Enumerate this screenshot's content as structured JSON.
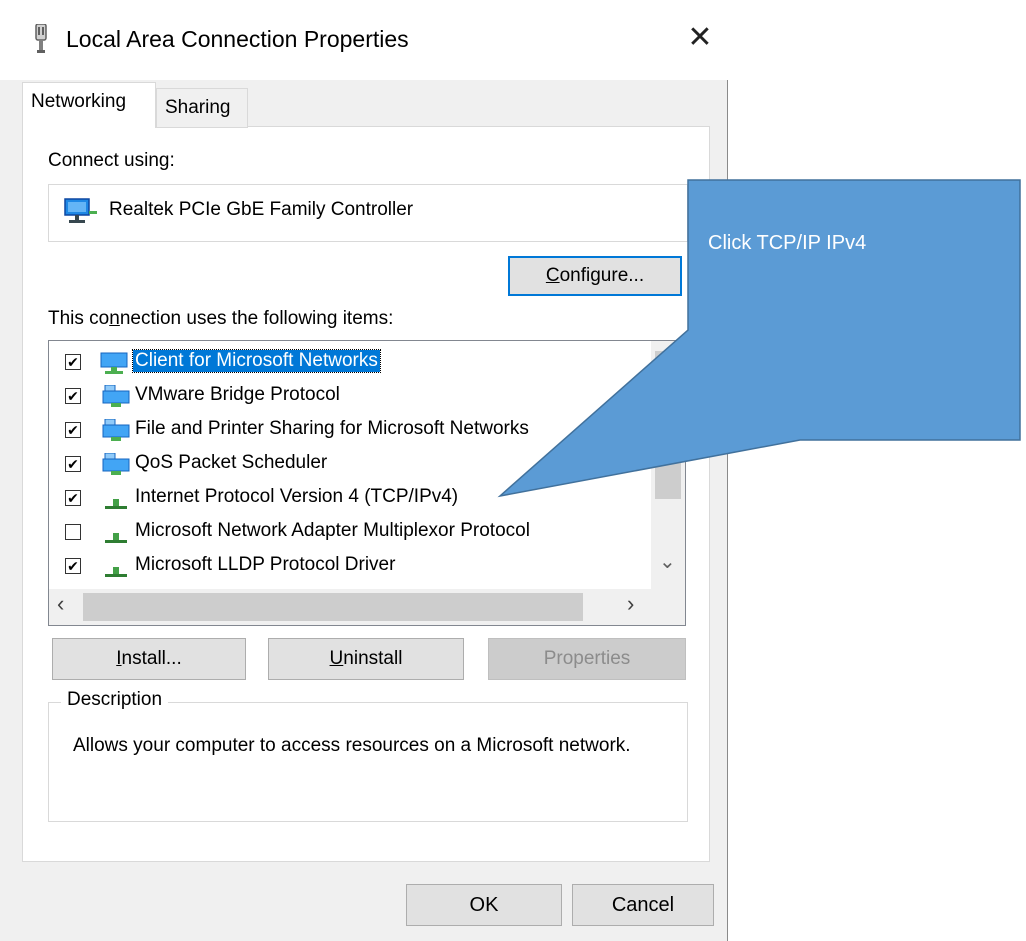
{
  "dialog": {
    "title": "Local Area Connection Properties",
    "close_glyph": "✕"
  },
  "tabs": [
    {
      "label": "Networking",
      "active": true
    },
    {
      "label": "Sharing",
      "active": false
    }
  ],
  "connect_using": {
    "label": "Connect using:",
    "adapter": "Realtek PCIe GbE Family Controller"
  },
  "buttons": {
    "configure": {
      "prefix": "",
      "accel": "C",
      "rest": "onfigure..."
    },
    "install": {
      "prefix": "",
      "accel": "I",
      "rest": "nstall..."
    },
    "uninstall": {
      "prefix": "",
      "accel": "U",
      "rest": "ninstall"
    },
    "properties": {
      "label": "Properties"
    },
    "ok": "OK",
    "cancel": "Cancel"
  },
  "items_label": {
    "prefix": "This co",
    "accel": "n",
    "rest": "nection uses the following items:"
  },
  "items": [
    {
      "label": "Client for Microsoft Networks",
      "checked": true,
      "checkmark": "✔",
      "icon": "network-client-icon",
      "selected": true
    },
    {
      "label": "VMware Bridge Protocol",
      "checked": true,
      "checkmark": "✔",
      "icon": "network-service-icon",
      "selected": false
    },
    {
      "label": "File and Printer Sharing for Microsoft Networks",
      "checked": true,
      "checkmark": "✔",
      "icon": "network-service-icon",
      "selected": false
    },
    {
      "label": "QoS Packet Scheduler",
      "checked": true,
      "checkmark": "✔",
      "icon": "network-service-icon",
      "selected": false
    },
    {
      "label": "Internet Protocol Version 4 (TCP/IPv4)",
      "checked": true,
      "checkmark": "✔",
      "icon": "protocol-icon",
      "selected": false
    },
    {
      "label": "Microsoft Network Adapter Multiplexor Protocol",
      "checked": false,
      "checkmark": "",
      "icon": "protocol-icon",
      "selected": false
    },
    {
      "label": "Microsoft LLDP Protocol Driver",
      "checked": true,
      "checkmark": "✔",
      "icon": "protocol-icon",
      "selected": false
    }
  ],
  "scroll_glyphs": {
    "down": "⌄",
    "left": "‹",
    "right": "›"
  },
  "description": {
    "legend": "Description",
    "text": "Allows your computer to access resources on a Microsoft network."
  },
  "callout": {
    "text": "Click TCP/IP IPv4",
    "fill_color": "#5b9bd5",
    "stroke_color": "#41719c"
  },
  "colors": {
    "selection": "#0078d7",
    "dialog_bg": "#f0f0f0",
    "focus_border": "#0078d7"
  }
}
